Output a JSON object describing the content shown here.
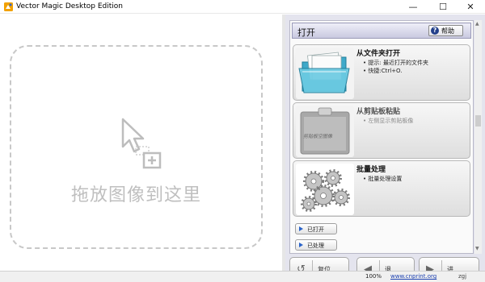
{
  "window": {
    "title": "Vector Magic Desktop Edition",
    "minimize": "—",
    "maximize": "☐",
    "close": "✕"
  },
  "drop_zone": {
    "text": "拖放图像到这里",
    "icon": "drag-drop-cursor-icon"
  },
  "panel": {
    "header_title": "打开",
    "help_label": "帮助",
    "cards": [
      {
        "title": "从文件夹打开",
        "bullets": [
          "提示: 最近打开的文件夹",
          "快捷:Ctrl+O."
        ],
        "icon": "folder-icon"
      },
      {
        "title": "从剪贴板粘贴",
        "bullets": [
          "左侧显示剪贴板像"
        ],
        "image_caption": "剪贴板空图像",
        "icon": "clipboard-icon"
      },
      {
        "title": "批量处理",
        "bullets": [
          "批量处理设置"
        ],
        "icon": "gears-icon"
      }
    ],
    "opened_label": "已打开",
    "more_label": "已处理"
  },
  "nav": {
    "reset": "复位",
    "back": "退",
    "next": "进"
  },
  "status": {
    "zoom": "100%",
    "link": "www.cnprint.org",
    "end_text": "zgj"
  },
  "colors": {
    "header_bg": "#c9c9e0",
    "panel_bg": "#e4e4ee",
    "help_icon": "#223f8a",
    "link": "#1a3fb0"
  }
}
